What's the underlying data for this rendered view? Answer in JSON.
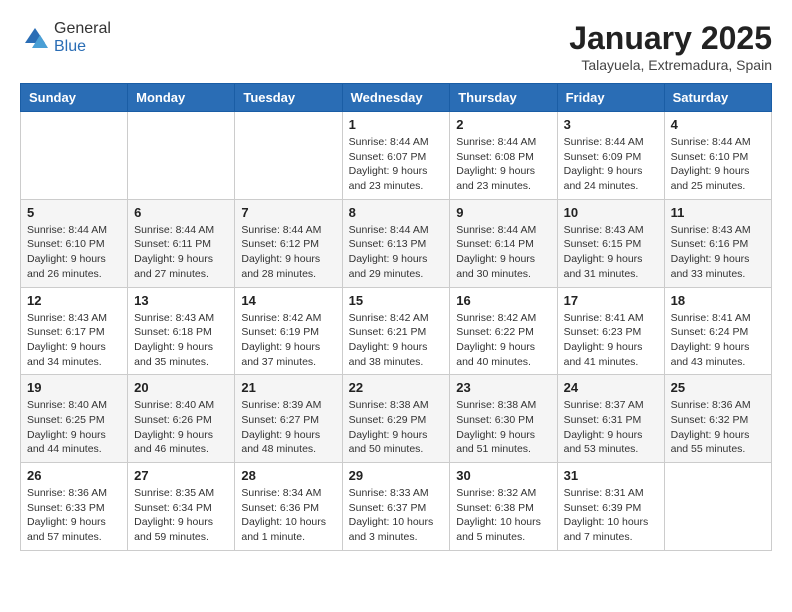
{
  "header": {
    "logo": {
      "general": "General",
      "blue": "Blue"
    },
    "title": "January 2025",
    "location": "Talayuela, Extremadura, Spain"
  },
  "weekdays": [
    "Sunday",
    "Monday",
    "Tuesday",
    "Wednesday",
    "Thursday",
    "Friday",
    "Saturday"
  ],
  "weeks": [
    [
      {
        "day": "",
        "info": ""
      },
      {
        "day": "",
        "info": ""
      },
      {
        "day": "",
        "info": ""
      },
      {
        "day": "1",
        "info": "Sunrise: 8:44 AM\nSunset: 6:07 PM\nDaylight: 9 hours and 23 minutes."
      },
      {
        "day": "2",
        "info": "Sunrise: 8:44 AM\nSunset: 6:08 PM\nDaylight: 9 hours and 23 minutes."
      },
      {
        "day": "3",
        "info": "Sunrise: 8:44 AM\nSunset: 6:09 PM\nDaylight: 9 hours and 24 minutes."
      },
      {
        "day": "4",
        "info": "Sunrise: 8:44 AM\nSunset: 6:10 PM\nDaylight: 9 hours and 25 minutes."
      }
    ],
    [
      {
        "day": "5",
        "info": "Sunrise: 8:44 AM\nSunset: 6:10 PM\nDaylight: 9 hours and 26 minutes."
      },
      {
        "day": "6",
        "info": "Sunrise: 8:44 AM\nSunset: 6:11 PM\nDaylight: 9 hours and 27 minutes."
      },
      {
        "day": "7",
        "info": "Sunrise: 8:44 AM\nSunset: 6:12 PM\nDaylight: 9 hours and 28 minutes."
      },
      {
        "day": "8",
        "info": "Sunrise: 8:44 AM\nSunset: 6:13 PM\nDaylight: 9 hours and 29 minutes."
      },
      {
        "day": "9",
        "info": "Sunrise: 8:44 AM\nSunset: 6:14 PM\nDaylight: 9 hours and 30 minutes."
      },
      {
        "day": "10",
        "info": "Sunrise: 8:43 AM\nSunset: 6:15 PM\nDaylight: 9 hours and 31 minutes."
      },
      {
        "day": "11",
        "info": "Sunrise: 8:43 AM\nSunset: 6:16 PM\nDaylight: 9 hours and 33 minutes."
      }
    ],
    [
      {
        "day": "12",
        "info": "Sunrise: 8:43 AM\nSunset: 6:17 PM\nDaylight: 9 hours and 34 minutes."
      },
      {
        "day": "13",
        "info": "Sunrise: 8:43 AM\nSunset: 6:18 PM\nDaylight: 9 hours and 35 minutes."
      },
      {
        "day": "14",
        "info": "Sunrise: 8:42 AM\nSunset: 6:19 PM\nDaylight: 9 hours and 37 minutes."
      },
      {
        "day": "15",
        "info": "Sunrise: 8:42 AM\nSunset: 6:21 PM\nDaylight: 9 hours and 38 minutes."
      },
      {
        "day": "16",
        "info": "Sunrise: 8:42 AM\nSunset: 6:22 PM\nDaylight: 9 hours and 40 minutes."
      },
      {
        "day": "17",
        "info": "Sunrise: 8:41 AM\nSunset: 6:23 PM\nDaylight: 9 hours and 41 minutes."
      },
      {
        "day": "18",
        "info": "Sunrise: 8:41 AM\nSunset: 6:24 PM\nDaylight: 9 hours and 43 minutes."
      }
    ],
    [
      {
        "day": "19",
        "info": "Sunrise: 8:40 AM\nSunset: 6:25 PM\nDaylight: 9 hours and 44 minutes."
      },
      {
        "day": "20",
        "info": "Sunrise: 8:40 AM\nSunset: 6:26 PM\nDaylight: 9 hours and 46 minutes."
      },
      {
        "day": "21",
        "info": "Sunrise: 8:39 AM\nSunset: 6:27 PM\nDaylight: 9 hours and 48 minutes."
      },
      {
        "day": "22",
        "info": "Sunrise: 8:38 AM\nSunset: 6:29 PM\nDaylight: 9 hours and 50 minutes."
      },
      {
        "day": "23",
        "info": "Sunrise: 8:38 AM\nSunset: 6:30 PM\nDaylight: 9 hours and 51 minutes."
      },
      {
        "day": "24",
        "info": "Sunrise: 8:37 AM\nSunset: 6:31 PM\nDaylight: 9 hours and 53 minutes."
      },
      {
        "day": "25",
        "info": "Sunrise: 8:36 AM\nSunset: 6:32 PM\nDaylight: 9 hours and 55 minutes."
      }
    ],
    [
      {
        "day": "26",
        "info": "Sunrise: 8:36 AM\nSunset: 6:33 PM\nDaylight: 9 hours and 57 minutes."
      },
      {
        "day": "27",
        "info": "Sunrise: 8:35 AM\nSunset: 6:34 PM\nDaylight: 9 hours and 59 minutes."
      },
      {
        "day": "28",
        "info": "Sunrise: 8:34 AM\nSunset: 6:36 PM\nDaylight: 10 hours and 1 minute."
      },
      {
        "day": "29",
        "info": "Sunrise: 8:33 AM\nSunset: 6:37 PM\nDaylight: 10 hours and 3 minutes."
      },
      {
        "day": "30",
        "info": "Sunrise: 8:32 AM\nSunset: 6:38 PM\nDaylight: 10 hours and 5 minutes."
      },
      {
        "day": "31",
        "info": "Sunrise: 8:31 AM\nSunset: 6:39 PM\nDaylight: 10 hours and 7 minutes."
      },
      {
        "day": "",
        "info": ""
      }
    ]
  ]
}
